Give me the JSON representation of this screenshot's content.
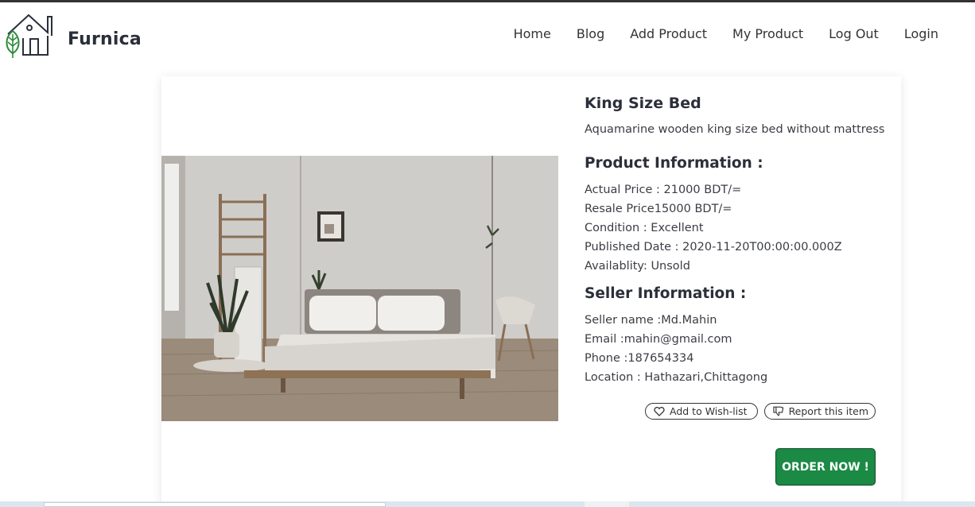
{
  "brand": {
    "name": "Furnica",
    "accent_color": "#1a8a45"
  },
  "nav": {
    "items": [
      "Home",
      "Blog",
      "Add Product",
      "My Product",
      "Log Out",
      "Login"
    ]
  },
  "product": {
    "title": "King Size Bed",
    "description": "Aquamarine wooden king size bed without mattress",
    "image_icon": "bedroom-photo"
  },
  "product_info": {
    "heading": "Product Information :",
    "actual_price": "Actual Price : 21000 BDT/=",
    "resale_price": "Resale Price15000 BDT/=",
    "condition": "Condition : Excellent",
    "published": "Published Date : 2020-11-20T00:00:00.000Z",
    "availability": "Availablity: Unsold"
  },
  "seller_info": {
    "heading": "Seller Information :",
    "name": "Seller name :Md.Mahin",
    "email": "Email :mahin@gmail.com",
    "phone": "Phone :187654334",
    "location": "Location : Hathazari,Chittagong"
  },
  "actions": {
    "wishlist": "Add to Wish-list",
    "wishlist_icon": "heart-icon",
    "report": "Report this item",
    "report_icon": "thumbs-down-icon",
    "order": "ORDER NOW !"
  }
}
